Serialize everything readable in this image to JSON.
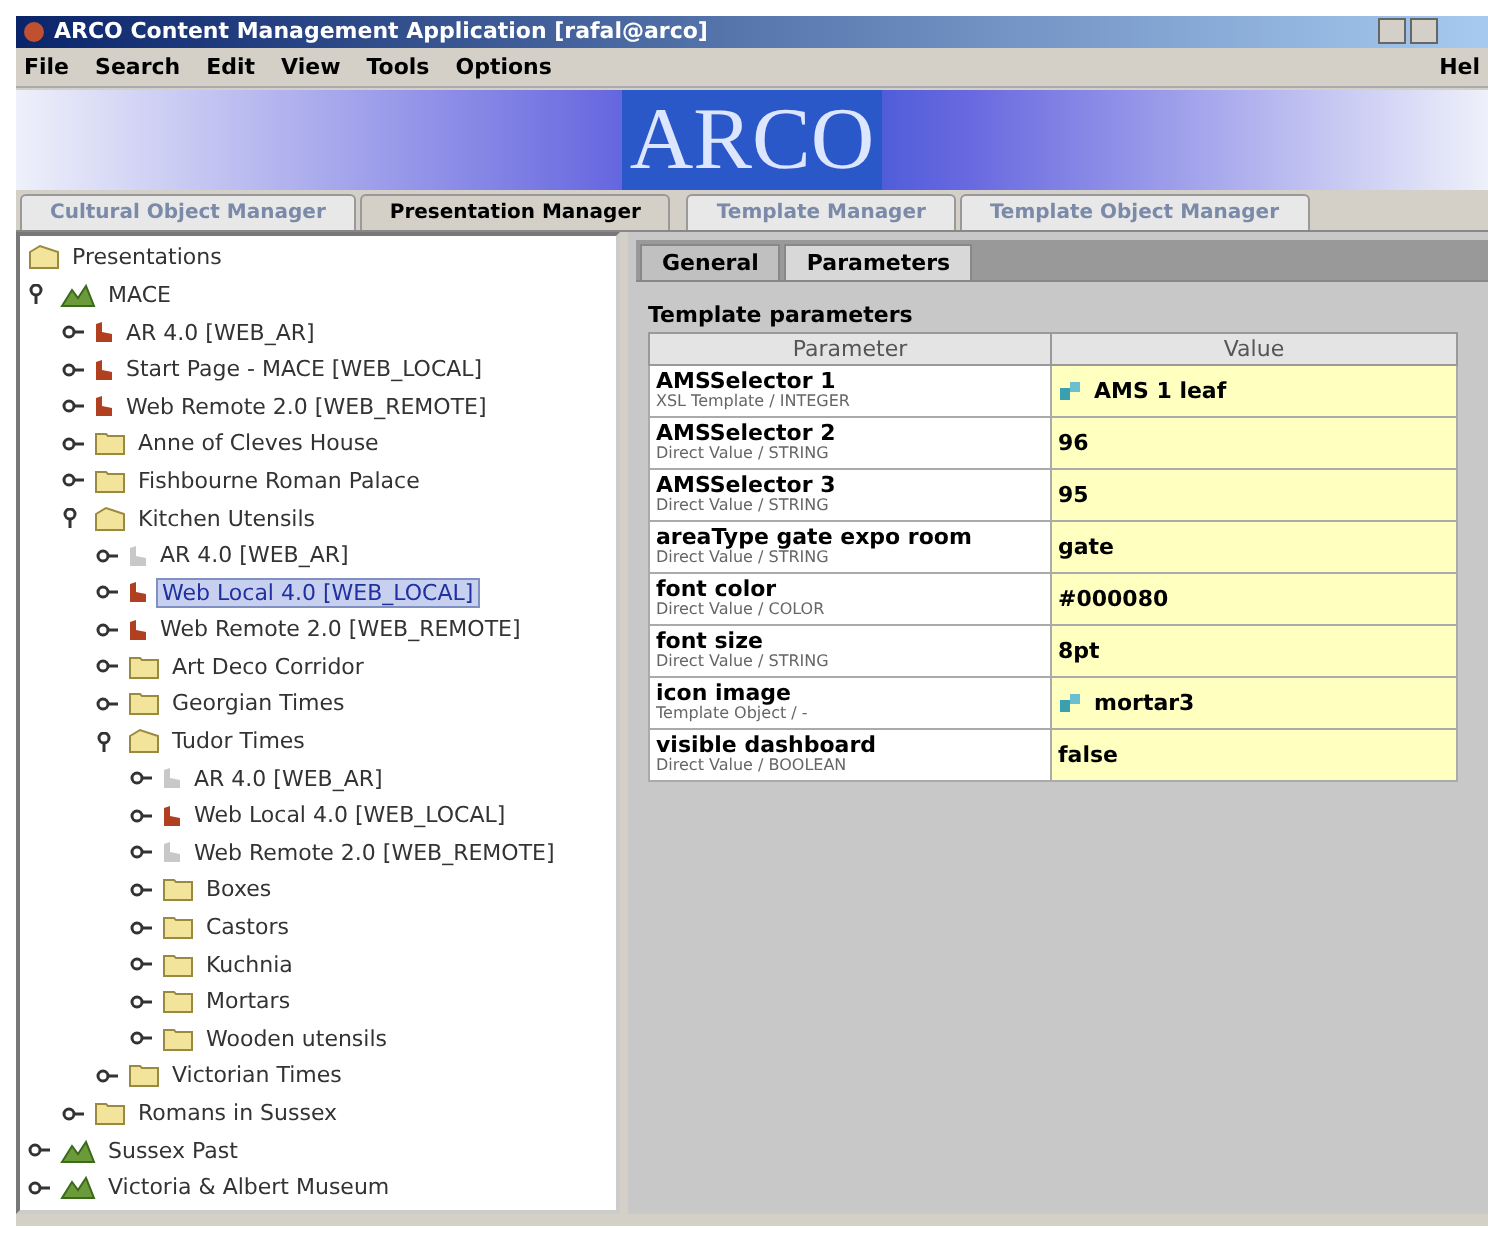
{
  "window": {
    "title": "ARCO Content Management Application [rafal@arco]"
  },
  "menu": [
    "File",
    "Search",
    "Edit",
    "View",
    "Tools",
    "Options"
  ],
  "menu_right": "Hel",
  "banner": {
    "logo": "ARCO"
  },
  "tabs": [
    {
      "label": "Cultural Object Manager",
      "selected": false
    },
    {
      "label": "Presentation Manager",
      "selected": true
    },
    {
      "label": "Template Manager",
      "selected": false
    },
    {
      "label": "Template Object Manager",
      "selected": false
    }
  ],
  "tree": [
    {
      "kind": "root",
      "label": "Presentations",
      "expanded": true,
      "children": [
        {
          "kind": "museum",
          "label": "MACE",
          "expanded": true,
          "children": [
            {
              "kind": "page",
              "label": "AR 4.0 [WEB_AR]",
              "enabled": true,
              "selected": false
            },
            {
              "kind": "page",
              "label": "Start Page - MACE [WEB_LOCAL]",
              "enabled": true,
              "selected": false
            },
            {
              "kind": "page",
              "label": "Web Remote 2.0 [WEB_REMOTE]",
              "enabled": true,
              "selected": false
            },
            {
              "kind": "folder",
              "label": "Anne of Cleves House",
              "expanded": false
            },
            {
              "kind": "folder",
              "label": "Fishbourne Roman Palace",
              "expanded": false
            },
            {
              "kind": "folder",
              "label": "Kitchen Utensils",
              "expanded": true,
              "children": [
                {
                  "kind": "page",
                  "label": "AR 4.0 [WEB_AR]",
                  "enabled": false,
                  "selected": false
                },
                {
                  "kind": "page",
                  "label": "Web Local 4.0 [WEB_LOCAL]",
                  "enabled": true,
                  "selected": true
                },
                {
                  "kind": "page",
                  "label": "Web Remote 2.0 [WEB_REMOTE]",
                  "enabled": true,
                  "selected": false
                },
                {
                  "kind": "folder",
                  "label": "Art Deco Corridor",
                  "expanded": false
                },
                {
                  "kind": "folder",
                  "label": "Georgian Times",
                  "expanded": false
                },
                {
                  "kind": "folder",
                  "label": "Tudor Times",
                  "expanded": true,
                  "children": [
                    {
                      "kind": "page",
                      "label": "AR 4.0 [WEB_AR]",
                      "enabled": false,
                      "selected": false
                    },
                    {
                      "kind": "page",
                      "label": "Web Local 4.0 [WEB_LOCAL]",
                      "enabled": true,
                      "selected": false
                    },
                    {
                      "kind": "page",
                      "label": "Web Remote 2.0 [WEB_REMOTE]",
                      "enabled": false,
                      "selected": false
                    },
                    {
                      "kind": "folder",
                      "label": "Boxes",
                      "expanded": false
                    },
                    {
                      "kind": "folder",
                      "label": "Castors",
                      "expanded": false
                    },
                    {
                      "kind": "folder",
                      "label": "Kuchnia",
                      "expanded": false
                    },
                    {
                      "kind": "folder",
                      "label": "Mortars",
                      "expanded": false
                    },
                    {
                      "kind": "folder",
                      "label": "Wooden utensils",
                      "expanded": false
                    }
                  ]
                },
                {
                  "kind": "folder",
                  "label": "Victorian Times",
                  "expanded": false
                }
              ]
            },
            {
              "kind": "folder",
              "label": "Romans in Sussex",
              "expanded": false
            }
          ]
        },
        {
          "kind": "museum",
          "label": "Sussex Past",
          "expanded": false
        },
        {
          "kind": "museum",
          "label": "Victoria & Albert Museum",
          "expanded": false
        }
      ]
    }
  ],
  "subtabs": [
    {
      "label": "General",
      "selected": false
    },
    {
      "label": "Parameters",
      "selected": true
    }
  ],
  "parameters": {
    "title": "Template parameters",
    "columns": [
      "Parameter",
      "Value"
    ],
    "rows": [
      {
        "name": "AMSSelector 1",
        "type": "XSL Template / INTEGER",
        "kind": "object",
        "value": "AMS 1 leaf"
      },
      {
        "name": "AMSSelector 2",
        "type": "Direct Value / STRING",
        "kind": "text",
        "value": "96"
      },
      {
        "name": "AMSSelector 3",
        "type": "Direct Value / STRING",
        "kind": "text",
        "value": "95"
      },
      {
        "name": "areaType gate expo room",
        "type": "Direct Value / STRING",
        "kind": "text",
        "value": "gate"
      },
      {
        "name": "font color",
        "type": "Direct Value / COLOR",
        "kind": "text",
        "value": "#000080"
      },
      {
        "name": "font size",
        "type": "Direct Value / STRING",
        "kind": "text",
        "value": "8pt"
      },
      {
        "name": "icon image",
        "type": "Template Object / -",
        "kind": "object",
        "value": "mortar3"
      },
      {
        "name": "visible dashboard",
        "type": "Direct Value / BOOLEAN",
        "kind": "text",
        "value": "false"
      }
    ]
  }
}
